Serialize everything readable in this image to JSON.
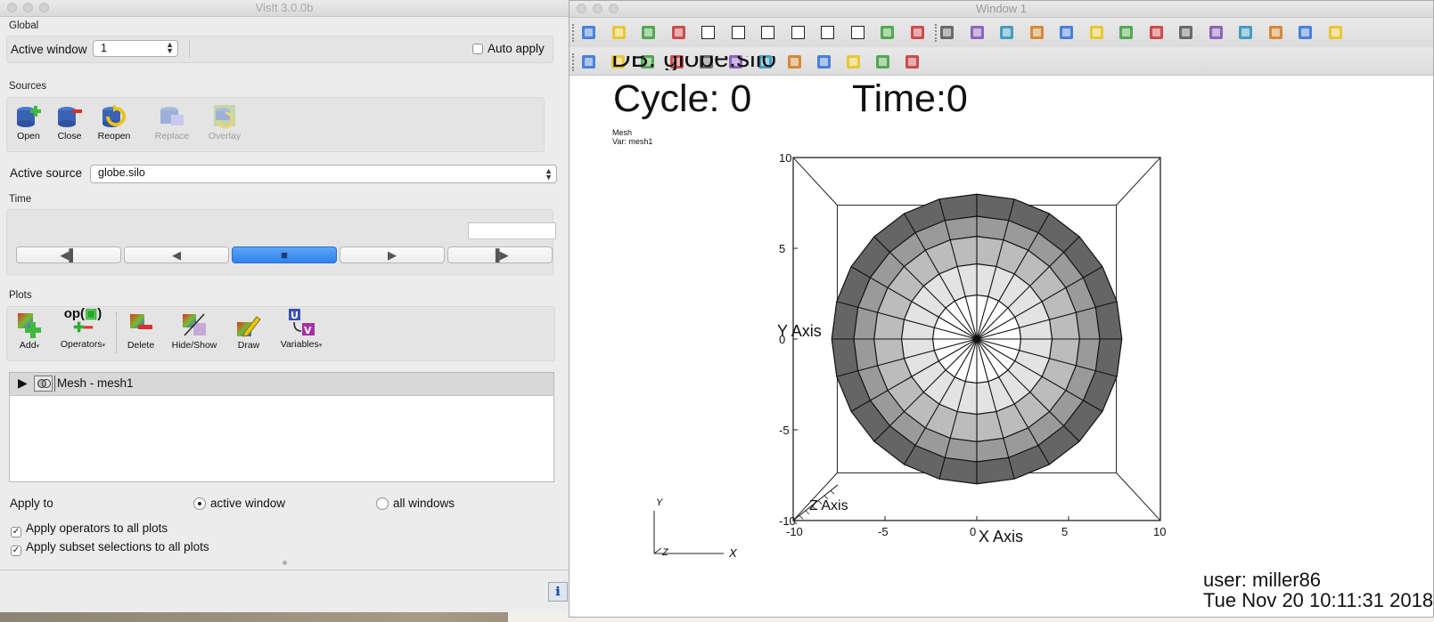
{
  "control_window": {
    "title": "VisIt 3.0.0b",
    "global": {
      "section": "Global",
      "active_window_label": "Active window",
      "active_window_value": "1",
      "auto_apply_label": "Auto apply",
      "auto_apply_checked": false
    },
    "sources": {
      "section": "Sources",
      "buttons": [
        "Open",
        "Close",
        "Reopen",
        "Replace",
        "Overlay"
      ],
      "active_source_label": "Active source",
      "active_source_value": "globe.silo"
    },
    "time": {
      "section": "Time",
      "buttons": [
        "step-back",
        "reverse",
        "stop",
        "play",
        "step-forward"
      ],
      "selected": "stop"
    },
    "plots": {
      "section": "Plots",
      "buttons": [
        "Add",
        "Operators",
        "Delete",
        "Hide/Show",
        "Draw",
        "Variables"
      ],
      "operators_icon_text": "op(",
      "plot_list": [
        {
          "label": "Mesh - mesh1"
        }
      ],
      "apply_to_label": "Apply to",
      "apply_active_window": "active window",
      "apply_all_windows": "all windows",
      "apply_to_selected": "active window",
      "apply_operators_label": "Apply operators to all plots",
      "apply_operators_checked": true,
      "apply_subset_label": "Apply subset selections to all plots",
      "apply_subset_checked": true
    }
  },
  "viz_window": {
    "title": "Window 1",
    "toolbar1_icons": [
      "toggle-check-icon",
      "new-window-icon",
      "clone-window-icon",
      "delete-window-icon",
      "layout-1x1-icon",
      "layout-1x2-icon",
      "layout-2x2-icon",
      "layout-2x3-icon",
      "layout-2x4-icon",
      "layout-3x3-icon",
      "spin-icon",
      "lock-view-icon",
      "perspective-cube-icon",
      "navigate-mode-icon",
      "zoom-mode-icon",
      "camera-icon",
      "camera2-icon",
      "save-image-icon",
      "camera3-icon",
      "globe-icon",
      "step-back-icon",
      "reverse-icon",
      "stop-icon",
      "more-icon",
      "color-table-icon",
      "person-icon"
    ],
    "toolbar2_icons": [
      "navigate-icon",
      "zoom-icon",
      "zone-pick-icon",
      "node-pick-icon",
      "spreadsheet-pick-icon",
      "curve-icon",
      "pick-arrow-icon",
      "lineout-icon",
      "plane-icon",
      "box-icon",
      "sphere-icon",
      "sliders-icon"
    ],
    "plot_header_partial": "DB: globe.silo",
    "cycle_text": "Cycle: 0",
    "time_text": "Time:0",
    "legend_plot": "Mesh",
    "legend_var": "Var: mesh1",
    "x_axis_label": "X Axis",
    "y_axis_label": "Y Axis",
    "z_axis_label": "Z Axis",
    "x_ticks": [
      "-10",
      "-5",
      "0",
      "5",
      "10"
    ],
    "y_ticks": [
      "10",
      "5",
      "0",
      "-5",
      "-10"
    ],
    "triad_labels": [
      "Y",
      "Z",
      "X"
    ],
    "user_text": "user: miller86",
    "date_text": "Tue Nov 20 10:11:31 2018",
    "mesh": {
      "rings": 4,
      "sectors": 24,
      "radii": [
        2.4,
        4.1,
        5.6,
        6.7,
        7.9
      ],
      "ring_fills": [
        "#ffffff",
        "#e3e3e3",
        "#bcbcbc",
        "#9a9a9a",
        "#656565"
      ]
    }
  }
}
